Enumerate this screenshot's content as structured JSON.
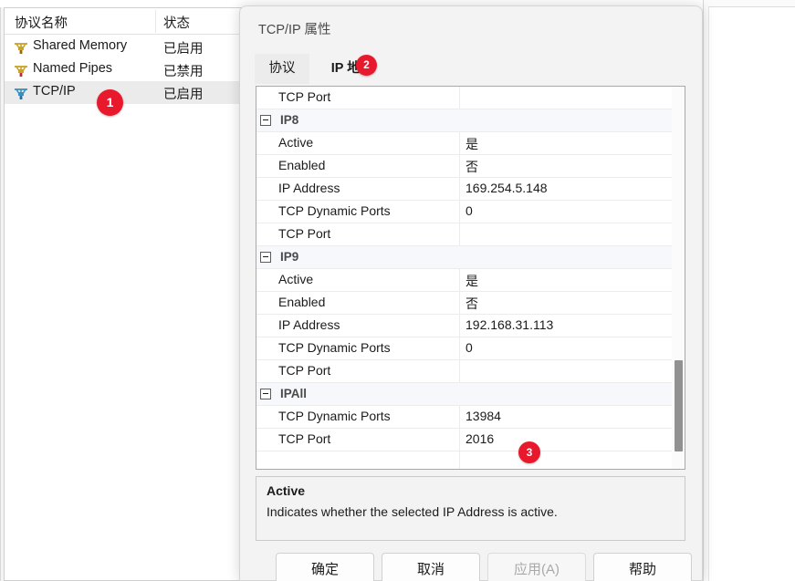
{
  "protocols_panel": {
    "columns": {
      "name": "协议名称",
      "state": "状态"
    },
    "rows": [
      {
        "icon": "network-protocol-icon",
        "label": "Shared Memory",
        "state": "已启用",
        "selected": false
      },
      {
        "icon": "network-protocol-icon",
        "label": "Named Pipes",
        "state": "已禁用",
        "selected": false
      },
      {
        "icon": "network-protocol-icon",
        "label": "TCP/IP",
        "state": "已启用",
        "selected": true
      }
    ]
  },
  "dialog": {
    "title": "TCP/IP 属性",
    "help_glyph": "?",
    "close_icon": "close-icon",
    "tabs": [
      {
        "label": "协议",
        "active": false
      },
      {
        "label": "IP 地址",
        "active": true
      }
    ],
    "grid": {
      "rows": [
        {
          "kind": "prop",
          "name": "TCP Port",
          "value": ""
        },
        {
          "kind": "group",
          "name": "IP8",
          "value": ""
        },
        {
          "kind": "prop",
          "name": "Active",
          "value": "是"
        },
        {
          "kind": "prop",
          "name": "Enabled",
          "value": "否"
        },
        {
          "kind": "prop",
          "name": "IP Address",
          "value": "169.254.5.148"
        },
        {
          "kind": "prop",
          "name": "TCP Dynamic Ports",
          "value": "0"
        },
        {
          "kind": "prop",
          "name": "TCP Port",
          "value": ""
        },
        {
          "kind": "group",
          "name": "IP9",
          "value": ""
        },
        {
          "kind": "prop",
          "name": "Active",
          "value": "是"
        },
        {
          "kind": "prop",
          "name": "Enabled",
          "value": "否"
        },
        {
          "kind": "prop",
          "name": "IP Address",
          "value": "192.168.31.113"
        },
        {
          "kind": "prop",
          "name": "TCP Dynamic Ports",
          "value": "0"
        },
        {
          "kind": "prop",
          "name": "TCP Port",
          "value": ""
        },
        {
          "kind": "group",
          "name": "IPAll",
          "value": ""
        },
        {
          "kind": "prop",
          "name": "TCP Dynamic Ports",
          "value": "13984"
        },
        {
          "kind": "prop",
          "name": "TCP Port",
          "value": "2016"
        },
        {
          "kind": "prop",
          "name": "",
          "value": ""
        }
      ]
    },
    "description": {
      "title": "Active",
      "body": "Indicates whether the selected IP Address is active."
    },
    "buttons": [
      {
        "label": "确定",
        "disabled": false
      },
      {
        "label": "取消",
        "disabled": false
      },
      {
        "label": "应用(A)",
        "disabled": true
      },
      {
        "label": "帮助",
        "disabled": false
      }
    ]
  },
  "badges": [
    {
      "id": "badge1",
      "label": "1"
    },
    {
      "id": "badge2",
      "label": "2"
    },
    {
      "id": "badge3",
      "label": "3"
    }
  ],
  "colors": {
    "badge_red": "#e8192c",
    "group_row_bg": "#f6f8fb",
    "selected_row_bg": "#ebebeb"
  }
}
